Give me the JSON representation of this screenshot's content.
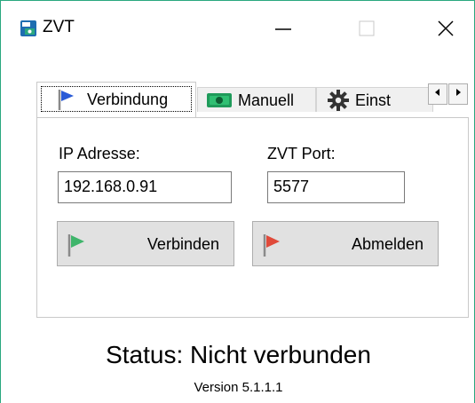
{
  "window": {
    "title": "ZVT",
    "controls": {
      "minimize": "minimize-icon",
      "maximize": "maximize-icon",
      "close": "close-icon"
    }
  },
  "tabs": [
    {
      "label": "Verbindung",
      "icon": "blue-flag-icon",
      "active": true
    },
    {
      "label": "Manuell",
      "icon": "cash-icon",
      "active": false
    },
    {
      "label": "Einst",
      "icon": "gear-icon",
      "active": false
    }
  ],
  "form": {
    "ip_label": "IP Adresse:",
    "ip_value": "192.168.0.91",
    "port_label": "ZVT Port:",
    "port_value": "5577"
  },
  "buttons": {
    "connect_label": "Verbinden",
    "logout_label": "Abmelden"
  },
  "status_text": "Status: Nicht verbunden",
  "version_text": "Version 5.1.1.1",
  "colors": {
    "window_border": "#2aa87f",
    "connect_flag": "#3fb56b",
    "logout_flag": "#e04a3a",
    "tab_flag": "#2a5bd7"
  }
}
